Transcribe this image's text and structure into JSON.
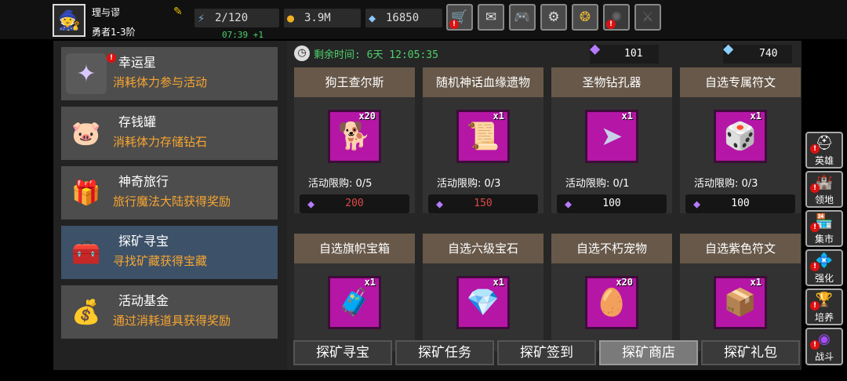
{
  "player": {
    "name": "理与谬",
    "rank": "勇者1-3阶",
    "avatar_icon": "hero-avatar-icon"
  },
  "resources": {
    "stamina": "2/120",
    "stamina_timer": "07:39 +1",
    "gold": "3.9M",
    "diamonds": "16850"
  },
  "top_buttons": [
    "shop-cart-icon",
    "mail-icon",
    "gamepad-icon",
    "settings-gear-icon",
    "aperture-icon",
    "fireworks-icon",
    "crossed-swords-icon"
  ],
  "activities": [
    {
      "title": "幸运星",
      "desc": "消耗体力参与活动"
    },
    {
      "title": "存钱罐",
      "desc": "消耗体力存储钻石"
    },
    {
      "title": "神奇旅行",
      "desc": "旅行魔法大陆获得奖励"
    },
    {
      "title": "探矿寻宝",
      "desc": "寻找矿藏获得宝藏"
    },
    {
      "title": "活动基金",
      "desc": "通过消耗道具获得奖励"
    }
  ],
  "shop": {
    "remaining_label": "剩余时间: 6天 12:05:35",
    "purple_crystals": "101",
    "blue_crystals": "740",
    "items_row1": [
      {
        "name": "狗王查尔斯",
        "qty": "x20",
        "limit": "活动限购: 0/5",
        "price": "200",
        "price_color": "#e04848"
      },
      {
        "name": "随机神话血缘遗物",
        "qty": "x1",
        "limit": "活动限购: 0/3",
        "price": "150",
        "price_color": "#e04848"
      },
      {
        "name": "圣物钻孔器",
        "qty": "x1",
        "limit": "活动限购: 0/1",
        "price": "100",
        "price_color": "#ffffff"
      },
      {
        "name": "自选专属符文",
        "qty": "x1",
        "limit": "活动限购: 0/3",
        "price": "100",
        "price_color": "#ffffff"
      }
    ],
    "items_row2": [
      {
        "name": "自选旗帜宝箱",
        "qty": "x1"
      },
      {
        "name": "自选六级宝石",
        "qty": "x1"
      },
      {
        "name": "自选不朽宠物",
        "qty": "x20"
      },
      {
        "name": "自选紫色符文",
        "qty": "x1"
      }
    ]
  },
  "tabs": [
    "探矿寻宝",
    "探矿任务",
    "探矿签到",
    "探矿商店",
    "探矿礼包"
  ],
  "active_tab": "探矿商店",
  "side_menu": [
    "英雄",
    "领地",
    "集市",
    "强化",
    "培养",
    "战斗"
  ]
}
